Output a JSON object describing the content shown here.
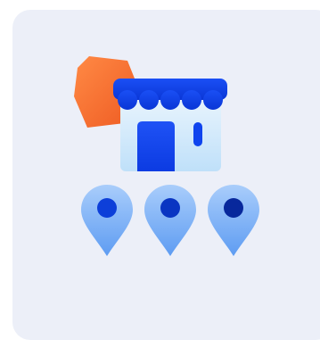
{
  "illustration": {
    "subject": "store-with-location-pins",
    "colors": {
      "card_background": "#eceff8",
      "hexagon": "#f26a2e",
      "awning": "#0c3de8",
      "store_body": "#d6ecfb",
      "door": "#0f44ee",
      "pin_light": "#7fb3f6",
      "pin_dot_1": "#0d3fd9",
      "pin_dot_2": "#0a35c2",
      "pin_dot_3": "#08289c"
    },
    "pins": [
      {
        "name": "location-pin-1"
      },
      {
        "name": "location-pin-2"
      },
      {
        "name": "location-pin-3"
      }
    ]
  }
}
